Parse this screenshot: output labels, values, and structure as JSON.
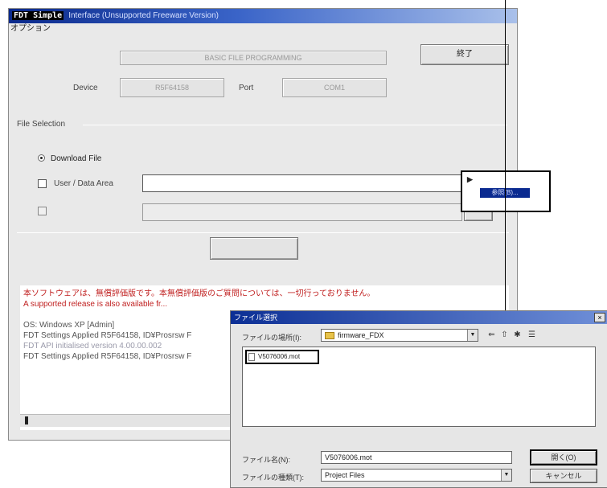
{
  "window": {
    "title_prefix": "FDT Simple",
    "title_rest": "Interface (Unsupported Freeware Version)",
    "menu": "オプション"
  },
  "program": {
    "header_field": "BASIC FILE PROGRAMMING",
    "exit_button": "終了",
    "device_label": "Device",
    "device_value": "R5F64158",
    "port_label": "Port",
    "port_value": "COM1"
  },
  "file_selection": {
    "group_label": "File Selection",
    "download_radio": "Download File",
    "user_data_checkbox": "User / Data Area",
    "user_data_path": "",
    "disabled_path": ""
  },
  "start_button": "",
  "log_lines": [
    {
      "text": "本ソフトウェアは、無償評価版です。本無償評価版のご質問については、一切行っておりません。",
      "style": "red"
    },
    {
      "text": "A supported release is also available fr...",
      "style": "red"
    },
    {
      "text": "",
      "style": "gray"
    },
    {
      "text": "OS: Windows XP [Admin]",
      "style": "gray"
    },
    {
      "text": "FDT Settings Applied R5F64158, ID¥Prosrsw F",
      "style": "gray"
    },
    {
      "text": "FDT API initialised version 4.00.00.002",
      "style": "gray2"
    },
    {
      "text": "FDT Settings Applied R5F64158, ID¥Prosrsw F",
      "style": "gray"
    }
  ],
  "popup": {
    "item_label": "参照(B)..."
  },
  "dialog": {
    "title": "ファイル選択",
    "close": "×",
    "look_in_label": "ファイルの場所(I):",
    "look_in_value": "firmware_FDX",
    "files": [
      "V5076006.mot"
    ],
    "filename_label": "ファイル名(N):",
    "filename_value": "V5076006.mot",
    "filetype_label": "ファイルの種類(T):",
    "filetype_value": "Project Files",
    "open_button": "開く(O)",
    "cancel_button": "キャンセル",
    "tools": [
      "⇐",
      "⇧",
      "✱",
      "☰"
    ]
  }
}
